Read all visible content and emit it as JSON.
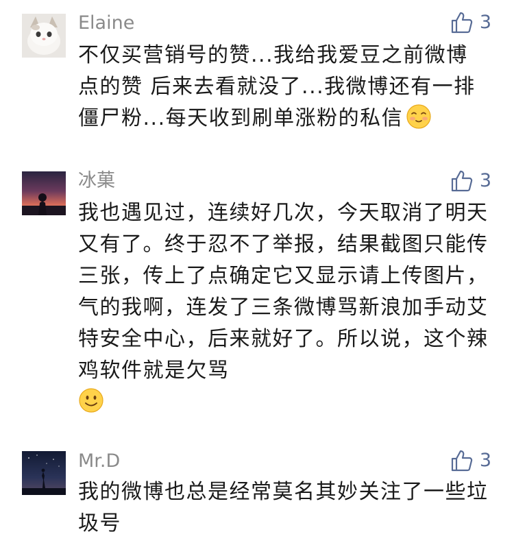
{
  "comments": [
    {
      "username": "Elaine",
      "avatar": "kitten-avatar",
      "likes": "3",
      "text": "不仅买营销号的赞...我给我爱豆之前微博点的赞 后来去看就没了...我微博还有一排僵尸粉...每天收到刷单涨粉的私信",
      "emoji": "blushing-smile-emoji"
    },
    {
      "username": "冰菓",
      "avatar": "sunset-silhouette-avatar",
      "likes": "3",
      "text": "我也遇见过，连续好几次，今天取消了明天又有了。终于忍不了举报，结果截图只能传三张，传上了点确定它又显示请上传图片，气的我啊，连发了三条微博骂新浪加手动艾特安全中心，后来就好了。所以说，这个辣鸡软件就是欠骂",
      "emoji": "smile-emoji"
    },
    {
      "username": "Mr.D",
      "avatar": "night-sky-avatar",
      "likes": "3",
      "text": "我的微博也总是经常莫名其妙关注了一些垃圾号",
      "emoji": ""
    }
  ],
  "colors": {
    "username": "#8a8a8a",
    "like_accent": "#576b95",
    "text": "#1a1a1a"
  },
  "icons": {
    "like": "thumbs-up-icon"
  }
}
